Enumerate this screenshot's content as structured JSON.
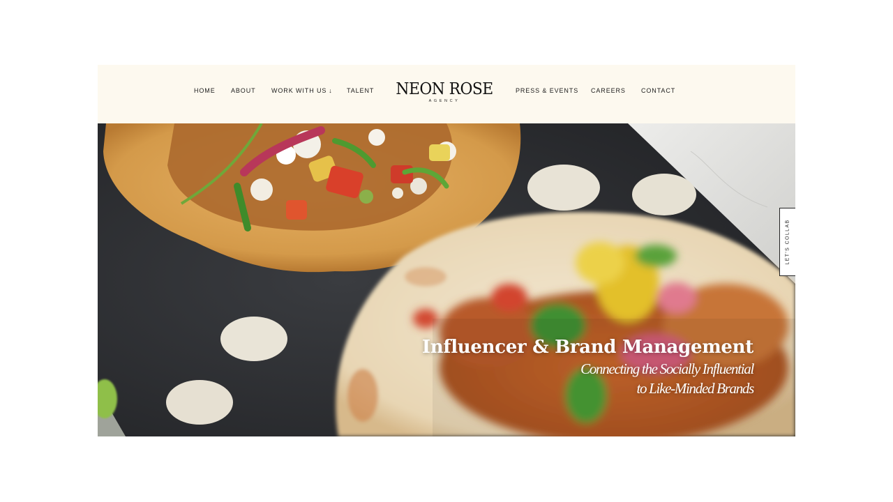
{
  "nav": {
    "home": "HOME",
    "about": "ABOUT",
    "work_with_us": "WORK WITH US",
    "work_with_us_arrow": "↓",
    "talent": "TALENT",
    "press_events": "PRESS & EVENTS",
    "careers": "CAREERS",
    "contact": "CONTACT"
  },
  "logo": {
    "name": "NEON ROSE",
    "tagline": "AGENCY"
  },
  "hero": {
    "image": "tacos-on-dark-slate-icon",
    "title": "Influencer & Brand Management",
    "subtitle_line1": "Connecting the Socially Influential",
    "subtitle_line2": "to Like-Minded Brands"
  },
  "side_tab": {
    "label": "LET'S COLLAB"
  },
  "colors": {
    "header_bg": "#fdf9ef",
    "hero_text": "#ffffff",
    "nav_text": "#1c1c1c"
  }
}
